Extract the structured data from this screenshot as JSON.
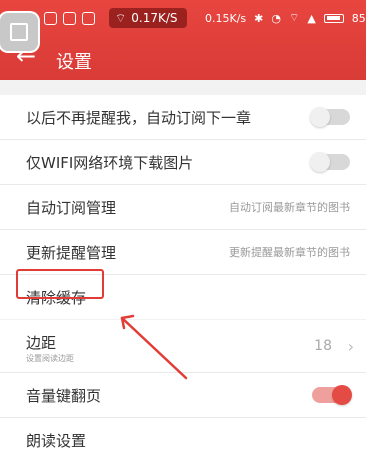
{
  "status_bar": {
    "speed_pill": "0.17K/S",
    "speed_text": "0.15K/s",
    "battery": "85%"
  },
  "header": {
    "title": "设置"
  },
  "settings": {
    "group1": [
      {
        "label": "以后不再提醒我，自动订阅下一章",
        "type": "toggle",
        "state": "off"
      },
      {
        "label": "仅WIFI网络环境下载图片",
        "type": "toggle",
        "state": "off"
      },
      {
        "label": "自动订阅管理",
        "value": "自动订阅最新章节的图书"
      },
      {
        "label": "更新提醒管理",
        "value": "更新提醒最新章节的图书"
      },
      {
        "label": "清除缓存"
      }
    ],
    "group2": [
      {
        "label": "边距",
        "subtitle": "设置阅读边距",
        "value": "18"
      },
      {
        "label": "音量键翻页",
        "type": "toggle",
        "state": "on"
      },
      {
        "label": "朗读设置"
      }
    ]
  },
  "colors": {
    "header": "#e23c36",
    "accent": "#e44b45"
  }
}
